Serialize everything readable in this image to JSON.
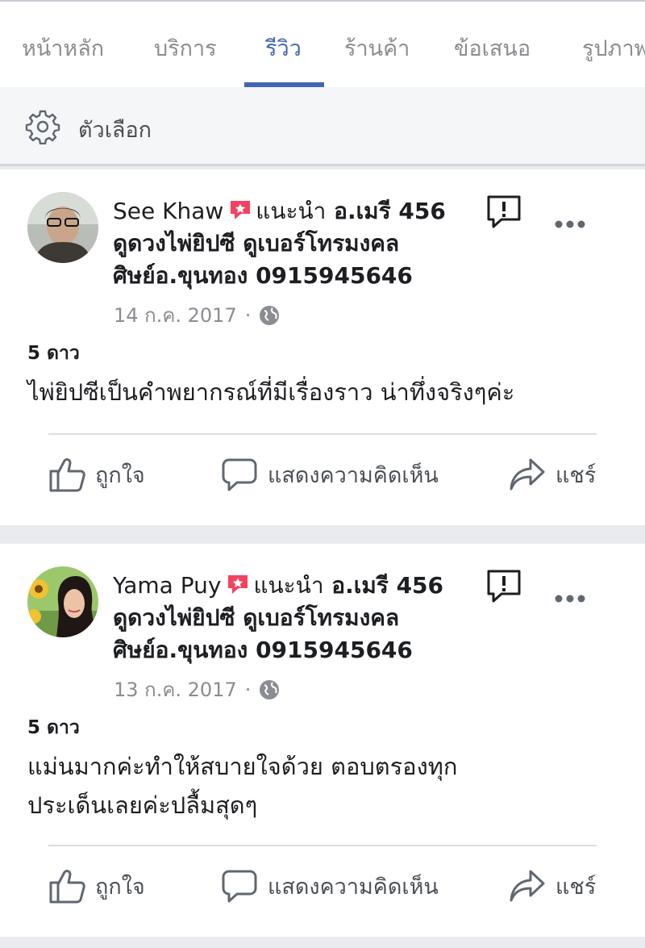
{
  "tabs": [
    {
      "label": "หน้าหลัก"
    },
    {
      "label": "บริการ"
    },
    {
      "label": "รีวิว"
    },
    {
      "label": "ร้านค้า"
    },
    {
      "label": "ข้อเสนอ"
    },
    {
      "label": "รูปภาพ"
    }
  ],
  "options_bar": {
    "label": "ตัวเลือก",
    "icon": "gear-icon"
  },
  "colors": {
    "accent": "#4267b2",
    "badge": "#f3425f",
    "text": "#1c1e21",
    "muted": "#8a8d91"
  },
  "reviews": [
    {
      "author": "See Khaw",
      "recommends": "แนะนำ",
      "page_line1": "อ.เมรี 456",
      "page_line2": "ดูดวงไพ่ยิปซี ดูเบอร์โทรมงคล",
      "page_line3": "ศิษย์อ.ขุนทอง 0915945646",
      "date": "14 ก.ค. 2017",
      "separator": "·",
      "rating": "5 ดาว",
      "text": "ไพ่ยิปซีเป็นคำพยากรณ์ที่มีเรื่องราว น่าทึ่งจริงๆค่ะ"
    },
    {
      "author": "Yama Puy",
      "recommends": "แนะนำ",
      "page_line1": "อ.เมรี 456",
      "page_line2": "ดูดวงไพ่ยิปซี ดูเบอร์โทรมงคล",
      "page_line3": "ศิษย์อ.ขุนทอง 0915945646",
      "date": "13 ก.ค. 2017",
      "separator": "·",
      "rating": "5 ดาว",
      "text_line1": "แม่นมากค่ะทำให้สบายใจด้วย ตอบตรองทุก",
      "text_line2": "ประเด็นเลยค่ะปลื้มสุดๆ"
    }
  ],
  "actions": {
    "like": "ถูกใจ",
    "comment": "แสดงความคิดเห็น",
    "share": "แชร์"
  }
}
